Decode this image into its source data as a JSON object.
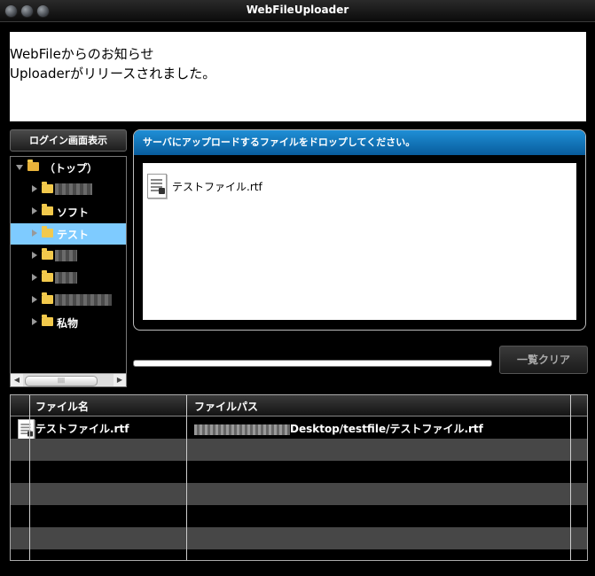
{
  "window": {
    "title": "WebFileUploader"
  },
  "notice": {
    "lines": [
      "WebFileからのお知らせ",
      "Uploaderがリリースされました。"
    ]
  },
  "sidebar": {
    "login_button": "ログイン画面表示",
    "tree": [
      {
        "label": "（トップ）",
        "expanded": true
      },
      {
        "label": "",
        "obscured": true
      },
      {
        "label": "ソフト"
      },
      {
        "label": "テスト",
        "selected": true
      },
      {
        "label": "",
        "obscured": true
      },
      {
        "label": "",
        "obscured": true
      },
      {
        "label": "",
        "obscured": true
      },
      {
        "label": "私物"
      }
    ]
  },
  "drop": {
    "header": "サーバにアップロードするファイルをドロップしてください。",
    "files": [
      {
        "name": "テストファイル.rtf",
        "icon": "document-icon"
      }
    ]
  },
  "actions": {
    "clear_label": "一覧クリア"
  },
  "progress": {
    "value": 0
  },
  "table": {
    "columns": [
      "ファイル名",
      "ファイルパス"
    ],
    "rows": [
      {
        "name": "テストファイル.rtf",
        "path_visible": "Desktop/testfile/テストファイル.rtf",
        "status_color": "#21b04a"
      }
    ]
  },
  "colors": {
    "accent": "#1f8fd6",
    "selection": "#7ecbff",
    "status_ok": "#21b04a"
  }
}
